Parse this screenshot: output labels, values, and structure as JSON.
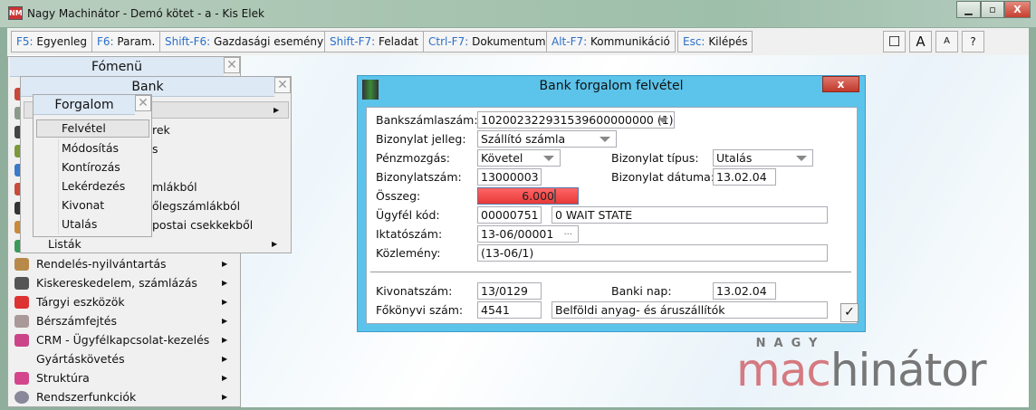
{
  "window": {
    "title": "Nagy Machinátor - Demó kötet - a - Kis Elek",
    "icon": "NM",
    "min": "▁",
    "max": "▫",
    "close": "X"
  },
  "toolbar": {
    "buttons": [
      {
        "key": "F5:",
        "label": "Egyenleg"
      },
      {
        "key": "F6:",
        "label": "Param."
      },
      {
        "key": "Shift-F6:",
        "label": "Gazdasági esemény"
      },
      {
        "key": "Shift-F7:",
        "label": "Feladat"
      },
      {
        "key": "Ctrl-F7:",
        "label": "Dokumentum"
      },
      {
        "key": "Alt-F7:",
        "label": "Kommunikáció"
      },
      {
        "key": "Esc:",
        "label": "Kilépés"
      }
    ],
    "right": {
      "window": "☐",
      "font_large": "A",
      "font_small": "A",
      "help": "?"
    }
  },
  "main_menu": {
    "title": "Fómenü",
    "close": "✕",
    "items": [
      {
        "label": "Rendelés-nyilvántartás"
      },
      {
        "label": "Kiskereskedelem, számlázás"
      },
      {
        "label": "Tárgyi eszközök"
      },
      {
        "label": "Bérszámfejtés"
      },
      {
        "label": "CRM - Ügyfélkapcsolat-kezelés"
      },
      {
        "label": "Gyártáskövetés"
      },
      {
        "label": "Struktúra"
      },
      {
        "label": "Rendszerfunkciók"
      }
    ]
  },
  "bank_menu": {
    "title": "Bank",
    "close": "✕",
    "partial_items": [
      "rek",
      "s",
      "",
      "mlákból",
      "őlegszámlákból",
      "postai csekkekből"
    ],
    "listak": "Listák"
  },
  "forgalom_menu": {
    "title": "Forgalom",
    "close": "✕",
    "items": [
      "Felvétel",
      "Módosítás",
      "Kontírozás",
      "Lekérdezés",
      "Kivonat",
      "Utalás"
    ],
    "selected": "Felvétel"
  },
  "dialog": {
    "title": "Bank forgalom felvétel",
    "close": "x",
    "fields": {
      "bankszamla": {
        "label": "Bankszámlaszám:",
        "value": "102002322931539600000000 (1)"
      },
      "jelleg": {
        "label": "Bizonylat jelleg:",
        "value": "Szállító számla"
      },
      "penzmozgas": {
        "label": "Pénzmozgás:",
        "value": "Követel"
      },
      "tipus": {
        "label": "Bizonylat típus:",
        "value": "Utalás"
      },
      "bizonylatszam": {
        "label": "Bizonylatszám:",
        "value": "13000003"
      },
      "datum": {
        "label": "Bizonylat dátuma:",
        "value": "13.02.04"
      },
      "osszeg": {
        "label": "Összeg:",
        "value": "6.000"
      },
      "ugyfel": {
        "label": "Ügyfél kód:",
        "value": "00000751",
        "name": "0 WAIT STATE"
      },
      "iktato": {
        "label": "Iktatószám:",
        "value": "13-06/00001",
        "browse": "..."
      },
      "kozlemeny": {
        "label": "Közlemény:",
        "value": "(13-06/1)"
      },
      "kivonat": {
        "label": "Kivonatszám:",
        "value": "13/0129"
      },
      "banki_nap": {
        "label": "Banki nap:",
        "value": "13.02.04"
      },
      "fokonyv": {
        "label": "Főkönyvi szám:",
        "value": "4541",
        "name": "Belföldi anyag- és áruszállítók"
      }
    },
    "ok": "✓"
  },
  "logo": {
    "top": "NAGY",
    "word_a": "mac",
    "word_b": "hinátor"
  },
  "colors": {
    "accent": "#5cc3ea",
    "error_field": "#f04848",
    "logo": "#d47a80"
  }
}
